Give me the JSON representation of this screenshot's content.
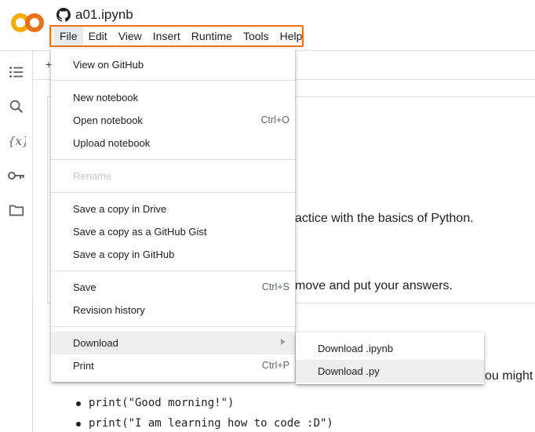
{
  "app": {
    "filename": "a01.ipynb",
    "logo": "colab-logo",
    "brand_colors": {
      "orange": "#f9ab00",
      "red_orange": "#e8711a"
    }
  },
  "menubar": {
    "items": [
      "File",
      "Edit",
      "View",
      "Insert",
      "Runtime",
      "Tools",
      "Help"
    ],
    "active": "File"
  },
  "sidebar": {
    "icons": [
      "table-of-contents-icon",
      "search-icon",
      "variables-icon",
      "key-icon",
      "folder-icon"
    ]
  },
  "toolbar": {
    "add_label": "+"
  },
  "notebook": {
    "text_1": "actice with the basics of Python.",
    "text_2": "move and put your answers.",
    "text_3": "ou might l",
    "code_1": "print(\"Good morning!\")",
    "code_2": "print(\"I am learning how to code :D\")"
  },
  "file_menu": {
    "view_github": "View on GitHub",
    "new_notebook": "New notebook",
    "open_notebook": "Open notebook",
    "open_shortcut": "Ctrl+O",
    "upload_notebook": "Upload notebook",
    "rename": "Rename",
    "save_drive": "Save a copy in Drive",
    "save_gist": "Save a copy as a GitHub Gist",
    "save_github": "Save a copy in GitHub",
    "save": "Save",
    "save_shortcut": "Ctrl+S",
    "revision_history": "Revision history",
    "download": "Download",
    "print": "Print",
    "print_shortcut": "Ctrl+P"
  },
  "download_submenu": {
    "ipynb": "Download .ipynb",
    "py": "Download .py"
  }
}
